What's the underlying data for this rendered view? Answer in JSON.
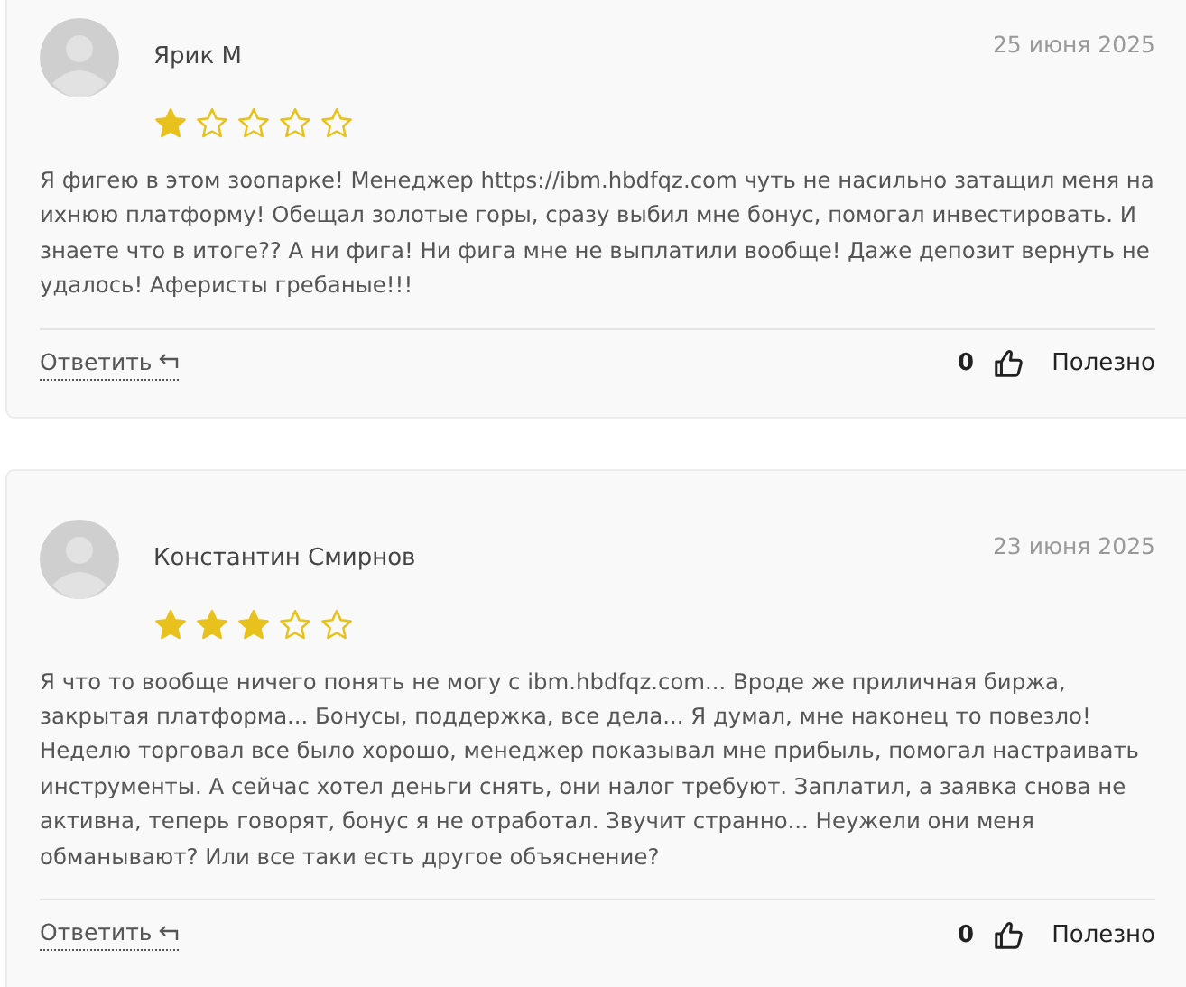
{
  "reviews": [
    {
      "author": "Ярик М",
      "date": "25 июня 2025",
      "stars": 1,
      "text": "Я фигею в этом зоопарке! Менеджер https://ibm.hbdfqz.com чуть не насильно затащил меня на ихнюю платформу! Обещал золотые горы, сразу выбил мне бонус, помогал инвестировать. И знаете что в итоге?? А ни фига! Ни фига мне не выплатили вообще! Даже депозит вернуть не удалось! Аферисты гребаные!!!",
      "reply": "Ответить",
      "likes": "0",
      "helpful": "Полезно"
    },
    {
      "author": "Константин Смирнов",
      "date": "23 июня 2025",
      "stars": 3,
      "text": "Я что то вообще ничего понять не могу с ibm.hbdfqz.com... Вроде же приличная биржа, закрытая платформа... Бонусы, поддержка, все дела... Я думал, мне наконец то повезло! Неделю торговал все было хорошо, менеджер показывал мне прибыль, помогал настраивать инструменты. А сейчас хотел деньги снять, они налог требуют. Заплатил, а заявка снова не активна, теперь говорят, бонус я не отработал. Звучит странно... Неужели они меня обманывают? Или все таки есть другое объяснение?",
      "reply": "Ответить",
      "likes": "0",
      "helpful": "Полезно"
    }
  ]
}
